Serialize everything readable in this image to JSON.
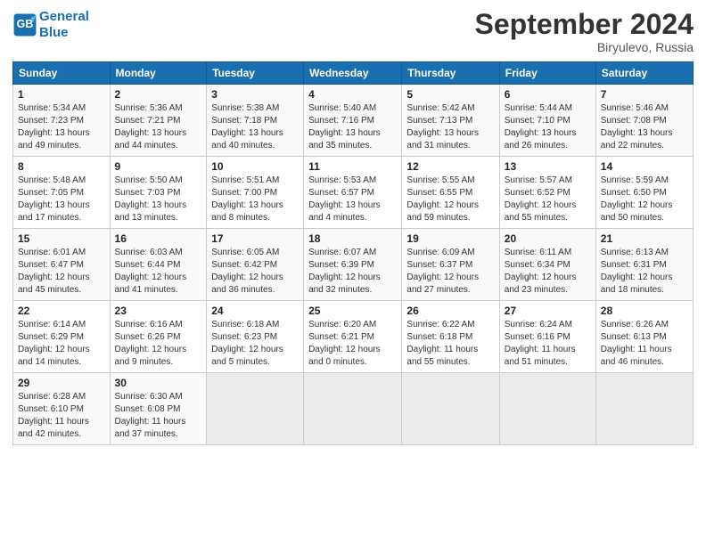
{
  "header": {
    "logo_line1": "General",
    "logo_line2": "Blue",
    "month_title": "September 2024",
    "location": "Biryulevo, Russia"
  },
  "weekdays": [
    "Sunday",
    "Monday",
    "Tuesday",
    "Wednesday",
    "Thursday",
    "Friday",
    "Saturday"
  ],
  "weeks": [
    [
      {
        "day": "1",
        "info": "Sunrise: 5:34 AM\nSunset: 7:23 PM\nDaylight: 13 hours\nand 49 minutes."
      },
      {
        "day": "2",
        "info": "Sunrise: 5:36 AM\nSunset: 7:21 PM\nDaylight: 13 hours\nand 44 minutes."
      },
      {
        "day": "3",
        "info": "Sunrise: 5:38 AM\nSunset: 7:18 PM\nDaylight: 13 hours\nand 40 minutes."
      },
      {
        "day": "4",
        "info": "Sunrise: 5:40 AM\nSunset: 7:16 PM\nDaylight: 13 hours\nand 35 minutes."
      },
      {
        "day": "5",
        "info": "Sunrise: 5:42 AM\nSunset: 7:13 PM\nDaylight: 13 hours\nand 31 minutes."
      },
      {
        "day": "6",
        "info": "Sunrise: 5:44 AM\nSunset: 7:10 PM\nDaylight: 13 hours\nand 26 minutes."
      },
      {
        "day": "7",
        "info": "Sunrise: 5:46 AM\nSunset: 7:08 PM\nDaylight: 13 hours\nand 22 minutes."
      }
    ],
    [
      {
        "day": "8",
        "info": "Sunrise: 5:48 AM\nSunset: 7:05 PM\nDaylight: 13 hours\nand 17 minutes."
      },
      {
        "day": "9",
        "info": "Sunrise: 5:50 AM\nSunset: 7:03 PM\nDaylight: 13 hours\nand 13 minutes."
      },
      {
        "day": "10",
        "info": "Sunrise: 5:51 AM\nSunset: 7:00 PM\nDaylight: 13 hours\nand 8 minutes."
      },
      {
        "day": "11",
        "info": "Sunrise: 5:53 AM\nSunset: 6:57 PM\nDaylight: 13 hours\nand 4 minutes."
      },
      {
        "day": "12",
        "info": "Sunrise: 5:55 AM\nSunset: 6:55 PM\nDaylight: 12 hours\nand 59 minutes."
      },
      {
        "day": "13",
        "info": "Sunrise: 5:57 AM\nSunset: 6:52 PM\nDaylight: 12 hours\nand 55 minutes."
      },
      {
        "day": "14",
        "info": "Sunrise: 5:59 AM\nSunset: 6:50 PM\nDaylight: 12 hours\nand 50 minutes."
      }
    ],
    [
      {
        "day": "15",
        "info": "Sunrise: 6:01 AM\nSunset: 6:47 PM\nDaylight: 12 hours\nand 45 minutes."
      },
      {
        "day": "16",
        "info": "Sunrise: 6:03 AM\nSunset: 6:44 PM\nDaylight: 12 hours\nand 41 minutes."
      },
      {
        "day": "17",
        "info": "Sunrise: 6:05 AM\nSunset: 6:42 PM\nDaylight: 12 hours\nand 36 minutes."
      },
      {
        "day": "18",
        "info": "Sunrise: 6:07 AM\nSunset: 6:39 PM\nDaylight: 12 hours\nand 32 minutes."
      },
      {
        "day": "19",
        "info": "Sunrise: 6:09 AM\nSunset: 6:37 PM\nDaylight: 12 hours\nand 27 minutes."
      },
      {
        "day": "20",
        "info": "Sunrise: 6:11 AM\nSunset: 6:34 PM\nDaylight: 12 hours\nand 23 minutes."
      },
      {
        "day": "21",
        "info": "Sunrise: 6:13 AM\nSunset: 6:31 PM\nDaylight: 12 hours\nand 18 minutes."
      }
    ],
    [
      {
        "day": "22",
        "info": "Sunrise: 6:14 AM\nSunset: 6:29 PM\nDaylight: 12 hours\nand 14 minutes."
      },
      {
        "day": "23",
        "info": "Sunrise: 6:16 AM\nSunset: 6:26 PM\nDaylight: 12 hours\nand 9 minutes."
      },
      {
        "day": "24",
        "info": "Sunrise: 6:18 AM\nSunset: 6:23 PM\nDaylight: 12 hours\nand 5 minutes."
      },
      {
        "day": "25",
        "info": "Sunrise: 6:20 AM\nSunset: 6:21 PM\nDaylight: 12 hours\nand 0 minutes."
      },
      {
        "day": "26",
        "info": "Sunrise: 6:22 AM\nSunset: 6:18 PM\nDaylight: 11 hours\nand 55 minutes."
      },
      {
        "day": "27",
        "info": "Sunrise: 6:24 AM\nSunset: 6:16 PM\nDaylight: 11 hours\nand 51 minutes."
      },
      {
        "day": "28",
        "info": "Sunrise: 6:26 AM\nSunset: 6:13 PM\nDaylight: 11 hours\nand 46 minutes."
      }
    ],
    [
      {
        "day": "29",
        "info": "Sunrise: 6:28 AM\nSunset: 6:10 PM\nDaylight: 11 hours\nand 42 minutes."
      },
      {
        "day": "30",
        "info": "Sunrise: 6:30 AM\nSunset: 6:08 PM\nDaylight: 11 hours\nand 37 minutes."
      },
      {
        "day": "",
        "info": ""
      },
      {
        "day": "",
        "info": ""
      },
      {
        "day": "",
        "info": ""
      },
      {
        "day": "",
        "info": ""
      },
      {
        "day": "",
        "info": ""
      }
    ]
  ]
}
